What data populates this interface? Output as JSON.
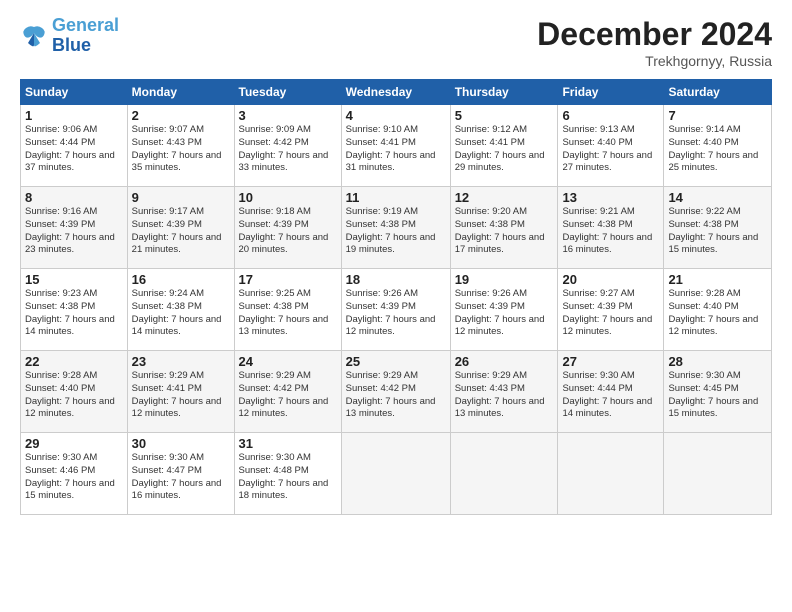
{
  "header": {
    "logo_line1": "General",
    "logo_line2": "Blue",
    "month": "December 2024",
    "location": "Trekhgornyy, Russia"
  },
  "weekdays": [
    "Sunday",
    "Monday",
    "Tuesday",
    "Wednesday",
    "Thursday",
    "Friday",
    "Saturday"
  ],
  "weeks": [
    [
      {
        "day": 1,
        "sunrise": "9:06 AM",
        "sunset": "4:44 PM",
        "daylight": "7 hours and 37 minutes."
      },
      {
        "day": 2,
        "sunrise": "9:07 AM",
        "sunset": "4:43 PM",
        "daylight": "7 hours and 35 minutes."
      },
      {
        "day": 3,
        "sunrise": "9:09 AM",
        "sunset": "4:42 PM",
        "daylight": "7 hours and 33 minutes."
      },
      {
        "day": 4,
        "sunrise": "9:10 AM",
        "sunset": "4:41 PM",
        "daylight": "7 hours and 31 minutes."
      },
      {
        "day": 5,
        "sunrise": "9:12 AM",
        "sunset": "4:41 PM",
        "daylight": "7 hours and 29 minutes."
      },
      {
        "day": 6,
        "sunrise": "9:13 AM",
        "sunset": "4:40 PM",
        "daylight": "7 hours and 27 minutes."
      },
      {
        "day": 7,
        "sunrise": "9:14 AM",
        "sunset": "4:40 PM",
        "daylight": "7 hours and 25 minutes."
      }
    ],
    [
      {
        "day": 8,
        "sunrise": "9:16 AM",
        "sunset": "4:39 PM",
        "daylight": "7 hours and 23 minutes."
      },
      {
        "day": 9,
        "sunrise": "9:17 AM",
        "sunset": "4:39 PM",
        "daylight": "7 hours and 21 minutes."
      },
      {
        "day": 10,
        "sunrise": "9:18 AM",
        "sunset": "4:39 PM",
        "daylight": "7 hours and 20 minutes."
      },
      {
        "day": 11,
        "sunrise": "9:19 AM",
        "sunset": "4:38 PM",
        "daylight": "7 hours and 19 minutes."
      },
      {
        "day": 12,
        "sunrise": "9:20 AM",
        "sunset": "4:38 PM",
        "daylight": "7 hours and 17 minutes."
      },
      {
        "day": 13,
        "sunrise": "9:21 AM",
        "sunset": "4:38 PM",
        "daylight": "7 hours and 16 minutes."
      },
      {
        "day": 14,
        "sunrise": "9:22 AM",
        "sunset": "4:38 PM",
        "daylight": "7 hours and 15 minutes."
      }
    ],
    [
      {
        "day": 15,
        "sunrise": "9:23 AM",
        "sunset": "4:38 PM",
        "daylight": "7 hours and 14 minutes."
      },
      {
        "day": 16,
        "sunrise": "9:24 AM",
        "sunset": "4:38 PM",
        "daylight": "7 hours and 14 minutes."
      },
      {
        "day": 17,
        "sunrise": "9:25 AM",
        "sunset": "4:38 PM",
        "daylight": "7 hours and 13 minutes."
      },
      {
        "day": 18,
        "sunrise": "9:26 AM",
        "sunset": "4:39 PM",
        "daylight": "7 hours and 12 minutes."
      },
      {
        "day": 19,
        "sunrise": "9:26 AM",
        "sunset": "4:39 PM",
        "daylight": "7 hours and 12 minutes."
      },
      {
        "day": 20,
        "sunrise": "9:27 AM",
        "sunset": "4:39 PM",
        "daylight": "7 hours and 12 minutes."
      },
      {
        "day": 21,
        "sunrise": "9:28 AM",
        "sunset": "4:40 PM",
        "daylight": "7 hours and 12 minutes."
      }
    ],
    [
      {
        "day": 22,
        "sunrise": "9:28 AM",
        "sunset": "4:40 PM",
        "daylight": "7 hours and 12 minutes."
      },
      {
        "day": 23,
        "sunrise": "9:29 AM",
        "sunset": "4:41 PM",
        "daylight": "7 hours and 12 minutes."
      },
      {
        "day": 24,
        "sunrise": "9:29 AM",
        "sunset": "4:42 PM",
        "daylight": "7 hours and 12 minutes."
      },
      {
        "day": 25,
        "sunrise": "9:29 AM",
        "sunset": "4:42 PM",
        "daylight": "7 hours and 13 minutes."
      },
      {
        "day": 26,
        "sunrise": "9:29 AM",
        "sunset": "4:43 PM",
        "daylight": "7 hours and 13 minutes."
      },
      {
        "day": 27,
        "sunrise": "9:30 AM",
        "sunset": "4:44 PM",
        "daylight": "7 hours and 14 minutes."
      },
      {
        "day": 28,
        "sunrise": "9:30 AM",
        "sunset": "4:45 PM",
        "daylight": "7 hours and 15 minutes."
      }
    ],
    [
      {
        "day": 29,
        "sunrise": "9:30 AM",
        "sunset": "4:46 PM",
        "daylight": "7 hours and 15 minutes."
      },
      {
        "day": 30,
        "sunrise": "9:30 AM",
        "sunset": "4:47 PM",
        "daylight": "7 hours and 16 minutes."
      },
      {
        "day": 31,
        "sunrise": "9:30 AM",
        "sunset": "4:48 PM",
        "daylight": "7 hours and 18 minutes."
      },
      null,
      null,
      null,
      null
    ]
  ]
}
